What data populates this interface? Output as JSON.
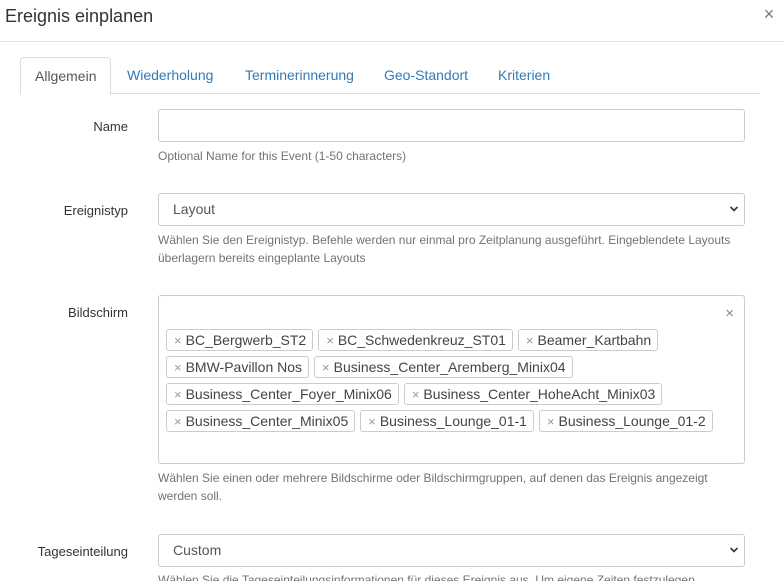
{
  "modal": {
    "title": "Ereignis einplanen",
    "close_label": "×"
  },
  "tabs": [
    {
      "label": "Allgemein"
    },
    {
      "label": "Wiederholung"
    },
    {
      "label": "Terminerinnerung"
    },
    {
      "label": "Geo-Standort"
    },
    {
      "label": "Kriterien"
    }
  ],
  "form": {
    "name": {
      "label": "Name",
      "value": "",
      "help": "Optional Name for this Event (1-50 characters)"
    },
    "event_type": {
      "label": "Ereignistyp",
      "value": "Layout",
      "help": "Wählen Sie den Ereignistyp. Befehle werden nur einmal pro Zeitplanung ausgeführt. Eingeblendete Layouts überlagern bereits eingeplante Layouts"
    },
    "displays": {
      "label": "Bildschirm",
      "clear_label": "×",
      "tags": [
        {
          "label": "BC_Bergwerb_ST2"
        },
        {
          "label": "BC_Schwedenkreuz_ST01"
        },
        {
          "label": "Beamer_Kartbahn"
        },
        {
          "label": "BMW-Pavillon Nos"
        },
        {
          "label": "Business_Center_Aremberg_Minix04"
        },
        {
          "label": "Business_Center_Foyer_Minix06"
        },
        {
          "label": "Business_Center_HoheAcht_Minix03"
        },
        {
          "label": "Business_Center_Minix05"
        },
        {
          "label": "Business_Lounge_01-1"
        },
        {
          "label": "Business_Lounge_01-2"
        }
      ],
      "tag_remove_label": "×",
      "help": "Wählen Sie einen oder mehrere Bildschirme oder Bildschirmgruppen, auf denen das Ereignis angezeigt werden soll."
    },
    "day_parting": {
      "label": "Tageseinteilung",
      "value": "Custom",
      "help": "Wählen Sie die Tageseinteilungsinformationen für dieses Ereignis aus. Um eigene Zeiten festzulegen"
    }
  }
}
